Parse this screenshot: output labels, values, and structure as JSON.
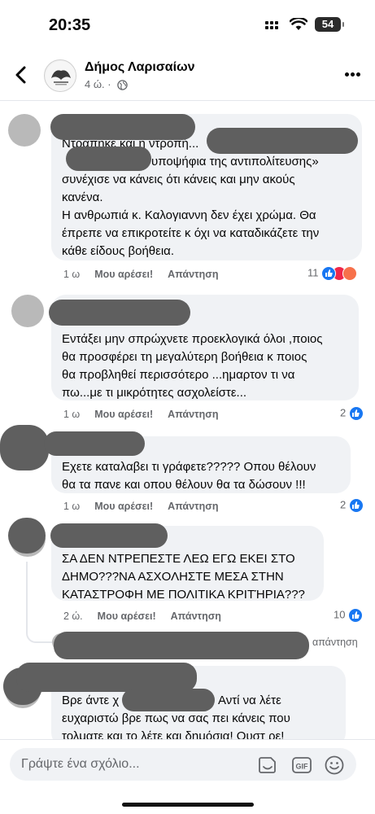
{
  "status_bar": {
    "time": "20:35",
    "battery": "54"
  },
  "header": {
    "page_name": "Δήμος Λαρισαίων",
    "post_age": "4 ώ. ·"
  },
  "comments": [
    {
      "lines": [
        "Ντράπηκε και η ντροπή...",
        "υποψήφια της αντιπολίτευσης»",
        "συνέχισε να κάνεις ότι κάνεις και μην ακούς",
        "κανένα.",
        "Η ανθρωπιά κ. Καλογιαννη δεν έχει χρώμα. Θα",
        "έπρεπε να επικροτείτε κ όχι να καταδικάζετε την",
        "κάθε είδους βοήθεια."
      ],
      "age": "1 ω",
      "like": "Μου αρέσει!",
      "reply": "Απάντηση",
      "reactions": "11"
    },
    {
      "lines": [
        "Εντάξει μην σπρώχνετε προεκλογικά όλοι ,ποιος",
        "θα προσφέρει τη μεγαλύτερη βοήθεια κ ποιος",
        "θα προβληθεί περισσότερο ...ημαρτον τι να",
        "πω...με τι μικρότητες ασχολείστε..."
      ],
      "age": "1 ω",
      "like": "Μου αρέσει!",
      "reply": "Απάντηση",
      "reactions": "2"
    },
    {
      "lines": [
        "Εχετε καταλαβει τι γράφετε????? Οπου θέλουν",
        "θα τα πανε και οπου θέλουν θα τα δώσουν !!!"
      ],
      "age": "1 ω",
      "like": "Μου αρέσει!",
      "reply": "Απάντηση",
      "reactions": "2"
    },
    {
      "lines": [
        "ΣΑ ΔΕΝ ΝΤΡΕΠΕΣΤΕ ΛΕΩ ΕΓΩ ΕΚΕΙ ΣΤΟ",
        "ΔΗΜΟ???ΝΑ ΑΣΧΟΛΗΣΤΕ ΜΕΣΑ ΣΤΗΝ",
        "ΚΑΤΑΣΤΡΟΦΗ ΜΕ ΠΟΛΙΤΙΚΑ ΚΡΙΤΉΡΙΑ???"
      ],
      "age": "2 ώ.",
      "like": "Μου αρέσει!",
      "reply": "Απάντηση",
      "reactions": "10",
      "nested_reply_label": "απάντηση"
    },
    {
      "lines": [
        "Βρε άντε χ",
        "Αντί να λέτε",
        "ευχαριστώ βρε πως να σας πει κάνεις που",
        "τολματε και το λέτε και δημόσια! Ουστ ρε!"
      ]
    }
  ],
  "composer": {
    "placeholder": "Γράψτε ένα σχόλιο...",
    "gif": "GIF"
  },
  "colors": {
    "accent": "#1877f2",
    "bubble": "#f0f2f5",
    "redaction": "#5f5f5f"
  }
}
